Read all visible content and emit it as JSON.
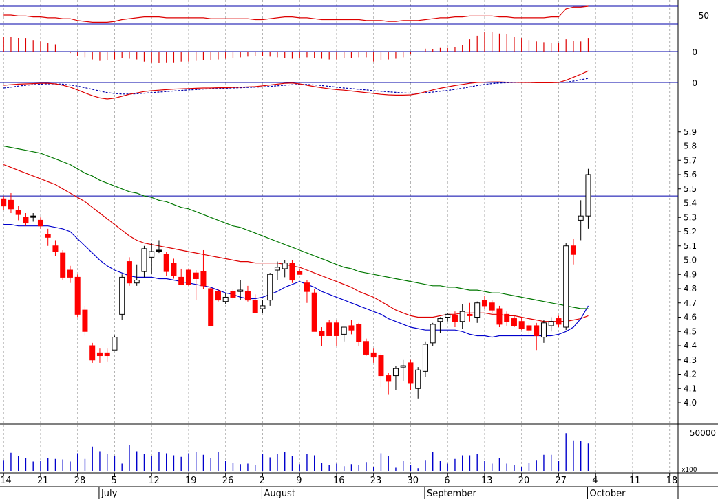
{
  "chart_data": {
    "type": "candlestick",
    "colors": {
      "up": "#ffffff",
      "down": "#ff0000",
      "doji": "#000000",
      "ma_short": "#0000cc",
      "ma_mid": "#dd0000",
      "ma_long": "#007700",
      "grid": "#b0b0b0",
      "hline": "#0000aa",
      "volume": "#0000cc",
      "osc1": "#dd0000",
      "osc_hist": "#dd0000",
      "osc_signal": "#0000aa"
    },
    "dates": [
      "Jun 14",
      "Jun 15",
      "Jun 16",
      "Jun 17",
      "Jun 18",
      "Jun 21",
      "Jun 22",
      "Jun 23",
      "Jun 24",
      "Jun 25",
      "Jun 28",
      "Jun 29",
      "Jun 30",
      "Jul 1",
      "Jul 2",
      "Jul 5",
      "Jul 6",
      "Jul 7",
      "Jul 8",
      "Jul 9",
      "Jul 12",
      "Jul 13",
      "Jul 14",
      "Jul 15",
      "Jul 16",
      "Jul 19",
      "Jul 20",
      "Jul 21",
      "Jul 22",
      "Jul 23",
      "Jul 26",
      "Jul 27",
      "Jul 28",
      "Jul 29",
      "Jul 30",
      "Aug 2",
      "Aug 3",
      "Aug 4",
      "Aug 5",
      "Aug 6",
      "Aug 9",
      "Aug 10",
      "Aug 11",
      "Aug 12",
      "Aug 13",
      "Aug 16",
      "Aug 17",
      "Aug 18",
      "Aug 19",
      "Aug 20",
      "Aug 23",
      "Aug 24",
      "Aug 25",
      "Aug 26",
      "Aug 27",
      "Aug 30",
      "Aug 31",
      "Sep 1",
      "Sep 2",
      "Sep 3",
      "Sep 6",
      "Sep 7",
      "Sep 8",
      "Sep 9",
      "Sep 10",
      "Sep 13",
      "Sep 14",
      "Sep 15",
      "Sep 16",
      "Sep 17",
      "Sep 20",
      "Sep 21",
      "Sep 22",
      "Sep 23",
      "Sep 24",
      "Sep 27",
      "Sep 28",
      "Sep 29",
      "Sep 30",
      "Oct 1"
    ],
    "ohlc": [
      [
        5.43,
        5.45,
        5.35,
        5.38
      ],
      [
        5.42,
        5.47,
        5.33,
        5.36
      ],
      [
        5.35,
        5.38,
        5.28,
        5.32
      ],
      [
        5.3,
        5.33,
        5.24,
        5.26
      ],
      [
        5.31,
        5.33,
        5.27,
        5.31
      ],
      [
        5.28,
        5.3,
        5.22,
        5.24
      ],
      [
        5.18,
        5.22,
        5.1,
        5.16
      ],
      [
        5.1,
        5.14,
        5.03,
        5.06
      ],
      [
        5.05,
        5.07,
        4.86,
        4.88
      ],
      [
        4.93,
        4.96,
        4.84,
        4.88
      ],
      [
        4.88,
        4.9,
        4.6,
        4.62
      ],
      [
        4.65,
        4.68,
        4.47,
        4.5
      ],
      [
        4.4,
        4.42,
        4.28,
        4.3
      ],
      [
        4.35,
        4.38,
        4.28,
        4.33
      ],
      [
        4.35,
        4.38,
        4.29,
        4.33
      ],
      [
        4.37,
        4.47,
        4.37,
        4.46
      ],
      [
        4.62,
        4.9,
        4.58,
        4.88
      ],
      [
        4.99,
        5.02,
        4.82,
        4.84
      ],
      [
        4.84,
        4.97,
        4.82,
        4.86
      ],
      [
        4.92,
        5.1,
        4.88,
        5.08
      ],
      [
        5.02,
        5.12,
        4.9,
        5.06
      ],
      [
        5.07,
        5.14,
        5.05,
        5.07
      ],
      [
        5.04,
        5.06,
        4.89,
        4.92
      ],
      [
        4.98,
        5.01,
        4.87,
        4.89
      ],
      [
        4.88,
        4.94,
        4.83,
        4.83
      ],
      [
        4.93,
        4.94,
        4.82,
        4.83
      ],
      [
        4.91,
        4.93,
        4.72,
        4.87
      ],
      [
        4.92,
        5.07,
        4.8,
        4.82
      ],
      [
        4.8,
        4.81,
        4.54,
        4.54
      ],
      [
        4.78,
        4.8,
        4.71,
        4.72
      ],
      [
        4.71,
        4.77,
        4.69,
        4.74
      ],
      [
        4.78,
        4.8,
        4.72,
        4.74
      ],
      [
        4.78,
        4.86,
        4.72,
        4.79
      ],
      [
        4.78,
        4.82,
        4.71,
        4.72
      ],
      [
        4.72,
        4.76,
        4.63,
        4.63
      ],
      [
        4.66,
        4.72,
        4.63,
        4.68
      ],
      [
        4.72,
        4.91,
        4.68,
        4.9
      ],
      [
        4.93,
        4.99,
        4.86,
        4.95
      ],
      [
        4.94,
        5.0,
        4.88,
        4.98
      ],
      [
        4.98,
        5.0,
        4.84,
        4.86
      ],
      [
        4.92,
        4.94,
        4.9,
        4.9
      ],
      [
        4.84,
        4.86,
        4.7,
        4.78
      ],
      [
        4.77,
        4.8,
        4.5,
        4.5
      ],
      [
        4.5,
        4.53,
        4.4,
        4.47
      ],
      [
        4.56,
        4.58,
        4.47,
        4.47
      ],
      [
        4.56,
        4.58,
        4.4,
        4.47
      ],
      [
        4.48,
        4.53,
        4.43,
        4.53
      ],
      [
        4.54,
        4.58,
        4.48,
        4.51
      ],
      [
        4.55,
        4.56,
        4.4,
        4.43
      ],
      [
        4.43,
        4.45,
        4.33,
        4.34
      ],
      [
        4.35,
        4.38,
        4.28,
        4.32
      ],
      [
        4.33,
        4.35,
        4.11,
        4.19
      ],
      [
        4.19,
        4.21,
        4.06,
        4.15
      ],
      [
        4.19,
        4.26,
        4.09,
        4.24
      ],
      [
        4.25,
        4.3,
        4.15,
        4.26
      ],
      [
        4.28,
        4.3,
        4.09,
        4.14
      ],
      [
        4.1,
        4.25,
        4.03,
        4.23
      ],
      [
        4.22,
        4.43,
        4.18,
        4.41
      ],
      [
        4.42,
        4.56,
        4.4,
        4.55
      ],
      [
        4.57,
        4.6,
        4.49,
        4.59
      ],
      [
        4.6,
        4.63,
        4.57,
        4.62
      ],
      [
        4.61,
        4.64,
        4.53,
        4.57
      ],
      [
        4.57,
        4.69,
        4.52,
        4.64
      ],
      [
        4.62,
        4.7,
        4.57,
        4.61
      ],
      [
        4.6,
        4.71,
        4.56,
        4.7
      ],
      [
        4.72,
        4.75,
        4.66,
        4.68
      ],
      [
        4.7,
        4.72,
        4.63,
        4.65
      ],
      [
        4.66,
        4.68,
        4.53,
        4.55
      ],
      [
        4.62,
        4.64,
        4.54,
        4.57
      ],
      [
        4.59,
        4.61,
        4.53,
        4.54
      ],
      [
        4.57,
        4.6,
        4.51,
        4.52
      ],
      [
        4.54,
        4.56,
        4.48,
        4.51
      ],
      [
        4.54,
        4.56,
        4.37,
        4.47
      ],
      [
        4.46,
        4.58,
        4.42,
        4.56
      ],
      [
        4.54,
        4.6,
        4.5,
        4.57
      ],
      [
        4.59,
        4.61,
        4.53,
        4.55
      ],
      [
        4.53,
        5.12,
        4.51,
        5.1
      ],
      [
        5.1,
        5.15,
        4.97,
        5.04
      ],
      [
        5.28,
        5.42,
        5.14,
        5.31
      ],
      [
        5.31,
        5.64,
        5.22,
        5.6
      ]
    ],
    "ma_short": [
      5.25,
      5.25,
      5.24,
      5.24,
      5.24,
      5.24,
      5.24,
      5.23,
      5.22,
      5.2,
      5.15,
      5.1,
      5.05,
      5.0,
      4.96,
      4.93,
      4.91,
      4.89,
      4.88,
      4.88,
      4.88,
      4.87,
      4.87,
      4.86,
      4.85,
      4.84,
      4.83,
      4.82,
      4.81,
      4.79,
      4.77,
      4.76,
      4.74,
      4.73,
      4.73,
      4.74,
      4.76,
      4.78,
      4.81,
      4.83,
      4.85,
      4.83,
      4.81,
      4.78,
      4.76,
      4.74,
      4.72,
      4.7,
      4.68,
      4.66,
      4.64,
      4.62,
      4.59,
      4.57,
      4.55,
      4.53,
      4.52,
      4.51,
      4.51,
      4.51,
      4.51,
      4.51,
      4.5,
      4.48,
      4.47,
      4.47,
      4.46,
      4.47,
      4.47,
      4.47,
      4.47,
      4.47,
      4.47,
      4.47,
      4.47,
      4.48,
      4.5,
      4.53,
      4.59,
      4.68
    ],
    "ma_mid": [
      5.67,
      5.65,
      5.63,
      5.61,
      5.59,
      5.57,
      5.55,
      5.53,
      5.5,
      5.47,
      5.44,
      5.41,
      5.37,
      5.33,
      5.29,
      5.25,
      5.21,
      5.17,
      5.14,
      5.12,
      5.11,
      5.1,
      5.09,
      5.08,
      5.07,
      5.06,
      5.05,
      5.04,
      5.03,
      5.02,
      5.01,
      5.0,
      4.99,
      4.99,
      4.98,
      4.98,
      4.98,
      4.98,
      4.97,
      4.96,
      4.95,
      4.93,
      4.91,
      4.89,
      4.87,
      4.85,
      4.83,
      4.81,
      4.78,
      4.76,
      4.74,
      4.71,
      4.68,
      4.65,
      4.63,
      4.61,
      4.6,
      4.6,
      4.6,
      4.61,
      4.62,
      4.62,
      4.63,
      4.63,
      4.63,
      4.63,
      4.62,
      4.62,
      4.61,
      4.61,
      4.6,
      4.59,
      4.58,
      4.57,
      4.57,
      4.57,
      4.57,
      4.58,
      4.59,
      4.61
    ],
    "ma_long": [
      5.8,
      5.79,
      5.78,
      5.77,
      5.76,
      5.75,
      5.73,
      5.71,
      5.69,
      5.67,
      5.64,
      5.61,
      5.59,
      5.56,
      5.54,
      5.52,
      5.5,
      5.48,
      5.47,
      5.45,
      5.44,
      5.42,
      5.41,
      5.39,
      5.37,
      5.36,
      5.34,
      5.32,
      5.3,
      5.28,
      5.26,
      5.24,
      5.23,
      5.21,
      5.19,
      5.17,
      5.15,
      5.13,
      5.11,
      5.09,
      5.07,
      5.05,
      5.03,
      5.01,
      4.99,
      4.97,
      4.95,
      4.94,
      4.92,
      4.91,
      4.9,
      4.89,
      4.88,
      4.87,
      4.86,
      4.85,
      4.84,
      4.83,
      4.82,
      4.82,
      4.81,
      4.81,
      4.8,
      4.79,
      4.79,
      4.78,
      4.77,
      4.77,
      4.76,
      4.75,
      4.74,
      4.73,
      4.72,
      4.71,
      4.7,
      4.69,
      4.68,
      4.67,
      4.66,
      4.66
    ],
    "volume": [
      21000,
      35000,
      28000,
      24000,
      18000,
      20000,
      25000,
      23000,
      22000,
      18000,
      34000,
      23000,
      47000,
      38000,
      33000,
      28000,
      14000,
      50000,
      38000,
      32000,
      28000,
      36000,
      34000,
      30000,
      27000,
      34000,
      37000,
      31000,
      25000,
      37000,
      20000,
      16000,
      13000,
      14000,
      12000,
      33000,
      26000,
      33000,
      37000,
      29000,
      13000,
      33000,
      30000,
      16000,
      12000,
      14000,
      9000,
      13000,
      12000,
      17000,
      8000,
      34000,
      28000,
      6000,
      20000,
      12000,
      5000,
      21000,
      36000,
      19000,
      14000,
      23000,
      30000,
      30000,
      32000,
      20000,
      14000,
      25000,
      14000,
      12000,
      8000,
      16000,
      21000,
      31000,
      31000,
      19000,
      73000,
      59000,
      58000,
      53000
    ],
    "osc_top_line": [
      0.9,
      0.9,
      0.89,
      0.89,
      0.88,
      0.88,
      0.87,
      0.87,
      0.86,
      0.86,
      0.84,
      0.83,
      0.82,
      0.82,
      0.82,
      0.83,
      0.85,
      0.86,
      0.87,
      0.88,
      0.88,
      0.88,
      0.87,
      0.87,
      0.87,
      0.87,
      0.87,
      0.87,
      0.86,
      0.86,
      0.86,
      0.86,
      0.86,
      0.86,
      0.85,
      0.85,
      0.86,
      0.87,
      0.88,
      0.88,
      0.87,
      0.87,
      0.86,
      0.85,
      0.85,
      0.85,
      0.85,
      0.85,
      0.85,
      0.84,
      0.84,
      0.84,
      0.83,
      0.83,
      0.84,
      0.84,
      0.84,
      0.85,
      0.86,
      0.87,
      0.87,
      0.88,
      0.88,
      0.89,
      0.89,
      0.89,
      0.89,
      0.88,
      0.88,
      0.87,
      0.87,
      0.87,
      0.87,
      0.87,
      0.88,
      0.88,
      0.97,
      0.99,
      0.99,
      1.0
    ],
    "osc_hist": [
      20,
      20,
      19,
      18,
      16,
      14,
      12,
      10,
      0,
      -2,
      -6,
      -8,
      -11,
      -13,
      -12,
      -11,
      -9,
      -10,
      -11,
      -14,
      -15,
      -16,
      -15,
      -15,
      -14,
      -14,
      -13,
      -12,
      -12,
      -11,
      -10,
      -9,
      -8,
      -7,
      -6,
      -6,
      -7,
      -8,
      -9,
      -10,
      -9,
      -8,
      -9,
      -10,
      -11,
      -11,
      -9,
      -9,
      -8,
      -8,
      -14,
      -12,
      -11,
      -10,
      -8,
      -4,
      0,
      4,
      3,
      5,
      5,
      6,
      9,
      17,
      22,
      27,
      27,
      25,
      24,
      20,
      18,
      16,
      14,
      13,
      12,
      12,
      17,
      15,
      14,
      18
    ],
    "osc_line": [
      -0.1,
      -0.08,
      -0.06,
      -0.05,
      -0.04,
      -0.03,
      -0.03,
      -0.05,
      -0.1,
      -0.17,
      -0.27,
      -0.38,
      -0.48,
      -0.56,
      -0.6,
      -0.57,
      -0.5,
      -0.43,
      -0.38,
      -0.33,
      -0.3,
      -0.28,
      -0.26,
      -0.24,
      -0.23,
      -0.22,
      -0.21,
      -0.2,
      -0.2,
      -0.19,
      -0.19,
      -0.18,
      -0.17,
      -0.16,
      -0.15,
      -0.12,
      -0.09,
      -0.06,
      -0.03,
      -0.02,
      -0.05,
      -0.1,
      -0.15,
      -0.19,
      -0.23,
      -0.26,
      -0.28,
      -0.31,
      -0.34,
      -0.37,
      -0.4,
      -0.43,
      -0.45,
      -0.46,
      -0.46,
      -0.45,
      -0.41,
      -0.34,
      -0.27,
      -0.21,
      -0.16,
      -0.11,
      -0.07,
      -0.03,
      0.0,
      0.01,
      0.02,
      0.02,
      0.01,
      0.01,
      0.0,
      0.0,
      -0.01,
      -0.01,
      -0.01,
      0.0,
      0.08,
      0.19,
      0.3,
      0.42
    ],
    "osc_signal": [
      -0.2,
      -0.17,
      -0.13,
      -0.1,
      -0.08,
      -0.06,
      -0.05,
      -0.05,
      -0.06,
      -0.09,
      -0.13,
      -0.19,
      -0.25,
      -0.31,
      -0.37,
      -0.4,
      -0.42,
      -0.42,
      -0.41,
      -0.39,
      -0.37,
      -0.35,
      -0.33,
      -0.31,
      -0.29,
      -0.27,
      -0.26,
      -0.24,
      -0.23,
      -0.22,
      -0.21,
      -0.2,
      -0.19,
      -0.18,
      -0.17,
      -0.16,
      -0.14,
      -0.12,
      -0.1,
      -0.08,
      -0.07,
      -0.07,
      -0.09,
      -0.11,
      -0.14,
      -0.17,
      -0.2,
      -0.22,
      -0.25,
      -0.27,
      -0.3,
      -0.32,
      -0.34,
      -0.36,
      -0.38,
      -0.39,
      -0.39,
      -0.37,
      -0.35,
      -0.32,
      -0.29,
      -0.25,
      -0.21,
      -0.16,
      -0.11,
      -0.07,
      -0.04,
      -0.02,
      -0.01,
      0.0,
      0.0,
      0.0,
      0.0,
      0.0,
      0.0,
      0.0,
      0.01,
      0.05,
      0.1,
      0.15
    ],
    "price_hline": 5.45,
    "price_ylim": [
      3.8,
      5.95
    ],
    "price_ticks": [
      "5.9",
      "5.8",
      "5.7",
      "5.6",
      "5.5",
      "5.4",
      "5.3",
      "5.2",
      "5.1",
      "5.0",
      "4.9",
      "4.8",
      "4.7",
      "4.6",
      "4.5",
      "4.4",
      "4.3",
      "4.2",
      "4.1",
      "4.0"
    ],
    "panel_labels": {
      "osc_top": "50",
      "osc_hist": "0",
      "osc_line": "0",
      "volume": "50000",
      "volume_unit": "x100"
    },
    "x_axis": {
      "day_labels": [
        {
          "label": "14",
          "index": 0
        },
        {
          "label": "21",
          "index": 5
        },
        {
          "label": "28",
          "index": 10
        },
        {
          "label": "5",
          "index": 15
        },
        {
          "label": "12",
          "index": 20
        },
        {
          "label": "19",
          "index": 25
        },
        {
          "label": "26",
          "index": 30
        },
        {
          "label": "2",
          "index": 35
        },
        {
          "label": "9",
          "index": 40
        },
        {
          "label": "16",
          "index": 45
        },
        {
          "label": "23",
          "index": 50
        },
        {
          "label": "30",
          "index": 55
        },
        {
          "label": "6",
          "index": 60
        },
        {
          "label": "13",
          "index": 65
        },
        {
          "label": "20",
          "index": 70
        },
        {
          "label": "27",
          "index": 75
        },
        {
          "label": "4",
          "index": 80
        },
        {
          "label": "11",
          "index": 85
        },
        {
          "label": "18",
          "index": 90
        }
      ],
      "month_labels": [
        {
          "label": "July",
          "index": 13
        },
        {
          "label": "August",
          "index": 35
        },
        {
          "label": "September",
          "index": 57
        },
        {
          "label": "October",
          "index": 79
        }
      ]
    }
  }
}
